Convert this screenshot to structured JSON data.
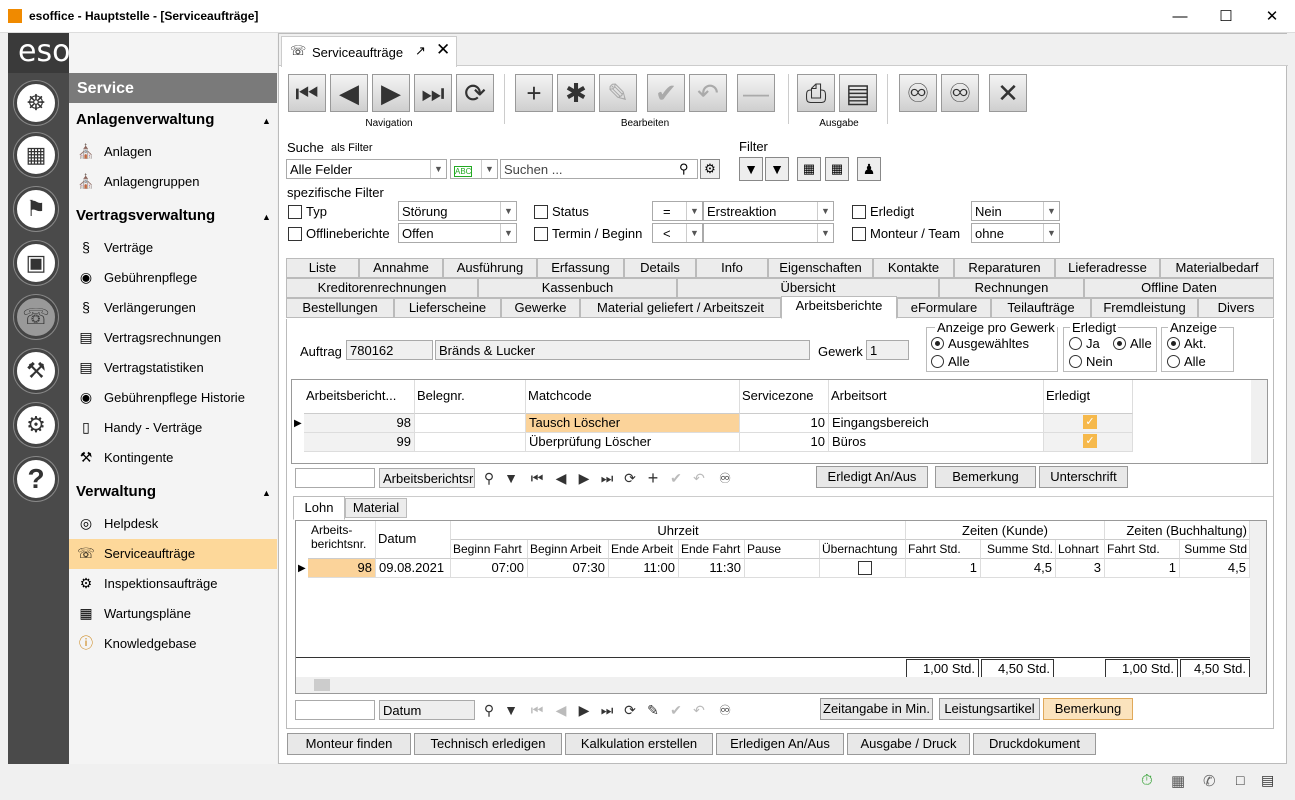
{
  "window": {
    "title": "esoffice - Hauptstelle - [Serviceaufträge]"
  },
  "logo": "esoffice",
  "sidebar": {
    "module": "Service",
    "groups": [
      {
        "title": "Anlagenverwaltung",
        "items": [
          "Anlagen",
          "Anlagengruppen"
        ]
      },
      {
        "title": "Vertragsverwaltung",
        "items": [
          "Verträge",
          "Gebührenpflege",
          "Verlängerungen",
          "Vertragsrechnungen",
          "Vertragstatistiken",
          "Gebührenpflege Historie",
          "Handy - Verträge",
          "Kontingente"
        ]
      },
      {
        "title": "Verwaltung",
        "items": [
          "Helpdesk",
          "Serviceaufträge",
          "Inspektionsaufträge",
          "Wartungspläne",
          "Knowledgebase"
        ]
      }
    ],
    "active": "Serviceaufträge"
  },
  "doc_tab": "Serviceaufträge",
  "toolbar": {
    "navigation": "Navigation",
    "bearbeiten": "Bearbeiten",
    "ausgabe": "Ausgabe"
  },
  "search": {
    "label": "Suche",
    "sub": "als Filter",
    "field": "Alle Felder",
    "placeholder": "Suchen ...",
    "filter": "Filter",
    "spec": "spezifische Filter"
  },
  "filters": {
    "typ": "Typ",
    "typ_val": "Störung",
    "offline": "Offlineberichte",
    "offline_val": "Offen",
    "status": "Status",
    "status_op": "=",
    "status_val": "Erstreaktion",
    "termin": "Termin / Beginn",
    "termin_op": "<",
    "termin_val": "",
    "erledigt": "Erledigt",
    "erledigt_val": "Nein",
    "monteur": "Monteur / Team",
    "monteur_val": "ohne"
  },
  "tabs": {
    "row1": [
      "Liste",
      "Annahme",
      "Ausführung",
      "Erfassung",
      "Details",
      "Info",
      "Eigenschaften",
      "Kontakte",
      "Reparaturen",
      "Lieferadresse",
      "Materialbedarf"
    ],
    "row2": [
      "Kreditorenrechnungen",
      "Kassenbuch",
      "Übersicht",
      "Rechnungen",
      "Offline Daten"
    ],
    "row3": [
      "Bestellungen",
      "Lieferscheine",
      "Gewerke",
      "Material geliefert / Arbeitszeit",
      "Arbeitsberichte",
      "eFormulare",
      "Teilaufträge",
      "Fremdleistung",
      "Divers"
    ],
    "selected": "Arbeitsberichte"
  },
  "auftrag": {
    "label": "Auftrag",
    "nr": "780162",
    "name": "Bränds & Lucker",
    "gewerk_label": "Gewerk",
    "gewerk": "1"
  },
  "anzeige_gewerk": {
    "title": "Anzeige pro Gewerk",
    "opt1": "Ausgewähltes",
    "opt2": "Alle"
  },
  "erledigt_grp": {
    "title": "Erledigt",
    "ja": "Ja",
    "alle": "Alle",
    "nein": "Nein"
  },
  "anzeige_grp": {
    "title": "Anzeige",
    "akt": "Akt.",
    "alle": "Alle"
  },
  "reports": {
    "headers": [
      "Arbeitsbericht...",
      "Belegnr.",
      "Matchcode",
      "Servicezone",
      "Arbeitsort",
      "Erledigt"
    ],
    "rows": [
      {
        "nr": "98",
        "beleg": "",
        "match": "Tausch Löscher",
        "zone": "10",
        "ort": "Eingangsbereich"
      },
      {
        "nr": "99",
        "beleg": "",
        "match": "Überprüfung Löscher",
        "zone": "10",
        "ort": "Büros"
      }
    ]
  },
  "nav1": {
    "field": "Arbeitsberichtsr",
    "b1": "Erledigt An/Aus",
    "b2": "Bemerkung",
    "b3": "Unterschrift"
  },
  "subtabs": [
    "Lohn",
    "Material"
  ],
  "lohn": {
    "group_uhrzeit": "Uhrzeit",
    "group_kunde": "Zeiten (Kunde)",
    "group_buch": "Zeiten (Buchhaltung)",
    "h_nr": "Arbeits-berichtsnr.",
    "h_datum": "Datum",
    "cols": [
      "Beginn Fahrt",
      "Beginn Arbeit",
      "Ende Arbeit",
      "Ende Fahrt",
      "Pause",
      "Übernachtung",
      "Fahrt Std.",
      "Summe Std.",
      "Lohnart",
      "Fahrt Std.",
      "Summe Std"
    ],
    "row": {
      "nr": "98",
      "datum": "09.08.2021",
      "bf": "07:00",
      "ba": "07:30",
      "ea": "11:00",
      "ef": "11:30",
      "pause": "",
      "fahrt": "1",
      "summe": "4,5",
      "lohnart": "3",
      "fahrt2": "1",
      "summe2": "4,5"
    },
    "totals": [
      "1,00 Std.",
      "4,50 Std.",
      "1,00 Std.",
      "4,50 Std."
    ]
  },
  "nav2": {
    "field": "Datum",
    "b1": "Zeitangabe in Min.",
    "b2": "Leistungsartikel",
    "b3": "Bemerkung"
  },
  "bottom": [
    "Monteur finden",
    "Technisch erledigen",
    "Kalkulation erstellen",
    "Erledigen An/Aus",
    "Ausgabe / Druck",
    "Druckdokument"
  ],
  "colors": {
    "accent": "#fdd89a",
    "rail": "#4a4a4a",
    "tick": "#f6b94c"
  }
}
